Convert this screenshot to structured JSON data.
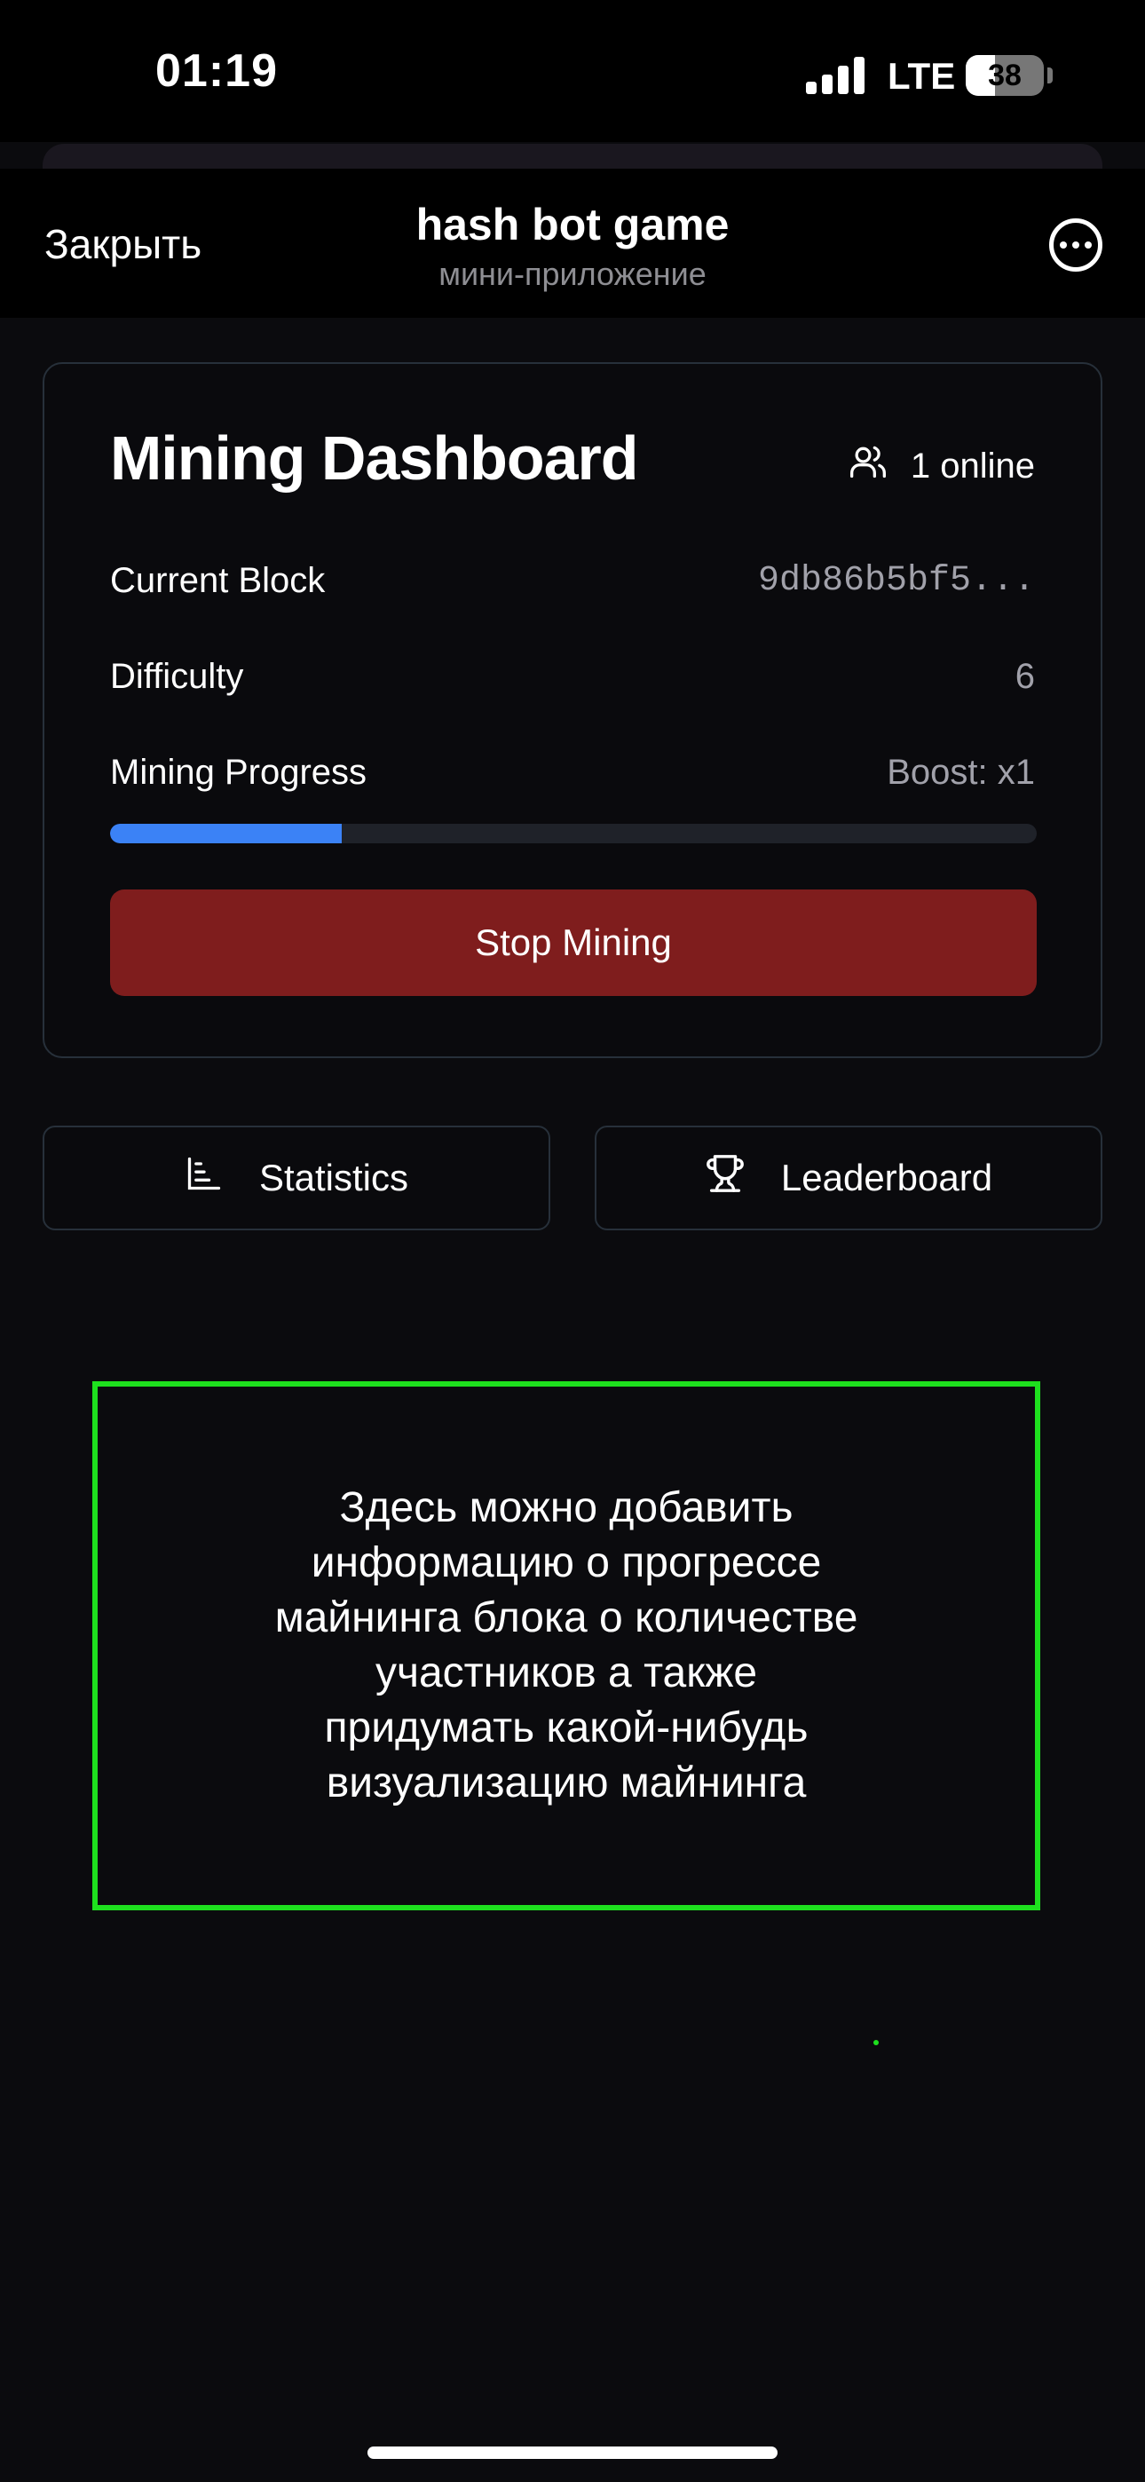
{
  "status_bar": {
    "time": "01:19",
    "network": "LTE",
    "battery": "38",
    "battery_level": 0.38
  },
  "header": {
    "close_label": "Закрыть",
    "title": "hash bot game",
    "subtitle": "мини-приложение",
    "more_icon": "more-circle-icon"
  },
  "dashboard": {
    "title": "Mining Dashboard",
    "online": "1 online",
    "online_icon": "users-icon",
    "current_block_label": "Current Block",
    "current_block_value": "9db86b5bf5...",
    "difficulty_label": "Difficulty",
    "difficulty_value": "6",
    "progress_label": "Mining Progress",
    "boost_label": "Boost: x1",
    "progress_fraction": 0.25,
    "progress_color": "#3b82f6",
    "stop_button_label": "Stop Mining",
    "stop_button_color": "#7f1d1d"
  },
  "nav": {
    "statistics_label": "Statistics",
    "statistics_icon": "bar-chart-icon",
    "leaderboard_label": "Leaderboard",
    "leaderboard_icon": "trophy-icon"
  },
  "annotation": {
    "text": "Здесь можно добавить\nинформацию о прогрессе\nмайнинга блока о количестве\nучастников а также\nпридумать какой-нибудь\nвизуализацию майнинга",
    "border_color": "#1ee01e"
  }
}
